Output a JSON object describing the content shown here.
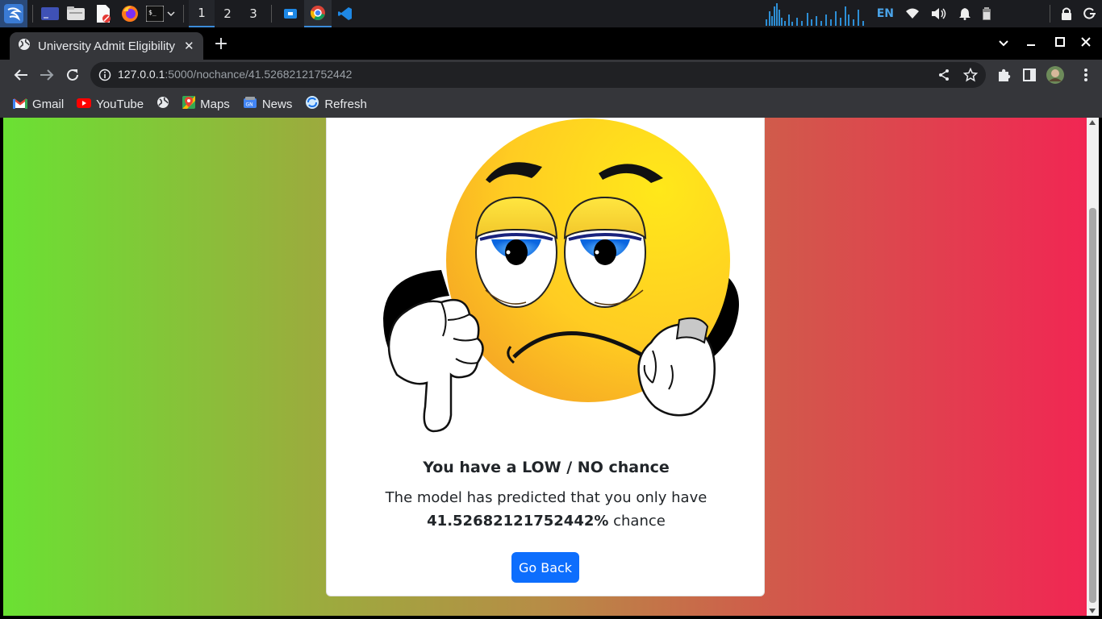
{
  "taskbar": {
    "workspaces": [
      "1",
      "2",
      "3"
    ],
    "active_workspace": "1",
    "language": "EN",
    "icons": [
      "kali-menu-icon",
      "desktop-icon",
      "file-manager-icon",
      "text-editor-icon",
      "firefox-icon",
      "terminal-icon",
      "chrome-icon",
      "vscode-icon"
    ]
  },
  "browser": {
    "tab_title": "University Admit Eligibility",
    "url_host": "127.0.0.1",
    "url_path": ":5000/nochance/41.52682121752442",
    "bookmarks": [
      {
        "label": "Gmail",
        "icon": "gmail-icon"
      },
      {
        "label": "YouTube",
        "icon": "youtube-icon"
      },
      {
        "label": "",
        "icon": "globe-icon"
      },
      {
        "label": "Maps",
        "icon": "maps-icon"
      },
      {
        "label": "News",
        "icon": "news-icon"
      },
      {
        "label": "Refresh",
        "icon": "refresh-icon"
      }
    ]
  },
  "page": {
    "heading": "You have a LOW / NO chance",
    "line1": "The model has predicted that you only have",
    "percent": "41.52682121752442%",
    "percent_suffix": " chance",
    "button": "Go Back",
    "gradient": [
      "#6ae133",
      "#f12653"
    ],
    "button_color": "#0d6efd"
  }
}
